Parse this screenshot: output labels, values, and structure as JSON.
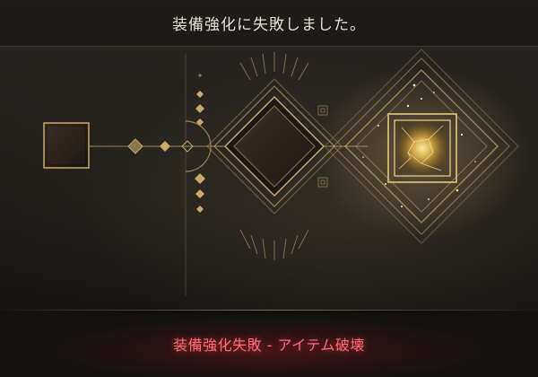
{
  "header": {
    "title": "装備強化に失敗しました。"
  },
  "result": {
    "message": "装備強化失敗 - アイテム破壊",
    "color": "#ff6d73"
  },
  "enhance_panel": {
    "base_slot_icon": "empty-equipment-slot",
    "center_slot_icon": "empty-diamond-slot",
    "result_slot_icon": "shattered-golden-item",
    "accent_color": "#c9a86a"
  }
}
